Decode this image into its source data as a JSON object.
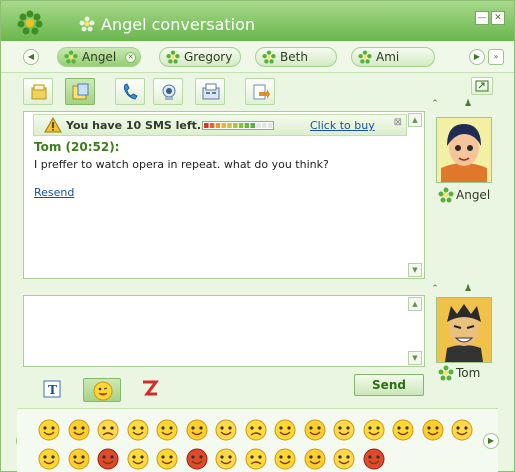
{
  "window": {
    "title": "Angel conversation",
    "minimize_glyph": "—",
    "close_glyph": "✕"
  },
  "tabs": [
    {
      "label": "Angel",
      "active": true,
      "closable": true
    },
    {
      "label": "Gregory",
      "active": false
    },
    {
      "label": "Beth",
      "active": false
    },
    {
      "label": "Ami",
      "active": false
    }
  ],
  "toolbar": {
    "tools": [
      "notes-icon",
      "sms-icon",
      "phone-icon",
      "webcam-icon",
      "fax-icon",
      "file-transfer-icon"
    ],
    "expand_icon": "expand-window-icon"
  },
  "sms_notice": {
    "text": "You have 10 SMS left.",
    "link": "Click to buy",
    "meter_fraction": 0.75
  },
  "messages": [
    {
      "header": "Tom (20:52):",
      "text": "I preffer to watch opera in repeat. what do you think?",
      "action": "Resend"
    }
  ],
  "contacts": {
    "remote": {
      "name": "Angel"
    },
    "local": {
      "name": "Tom"
    }
  },
  "composer": {
    "send_label": "Send",
    "format_tools": [
      "text-format-icon",
      "emoticon-icon",
      "nudge-icon"
    ]
  },
  "emoticons": {
    "row1": [
      "smile",
      "wink",
      "sad",
      "surprised",
      "grin",
      "cool",
      "tongue",
      "confused",
      "laugh",
      "blush",
      "sick",
      "angel",
      "kiss",
      "shy",
      "waving"
    ],
    "row2": [
      "sleepy",
      "smirk",
      "devil",
      "puzzled",
      "love",
      "angry",
      "nerd",
      "crying",
      "happy",
      "cold",
      "sheep",
      "heart"
    ]
  },
  "colors": {
    "accent": "#6bb64d",
    "link": "#1a4fa3",
    "message_header": "#3c7f1a"
  }
}
